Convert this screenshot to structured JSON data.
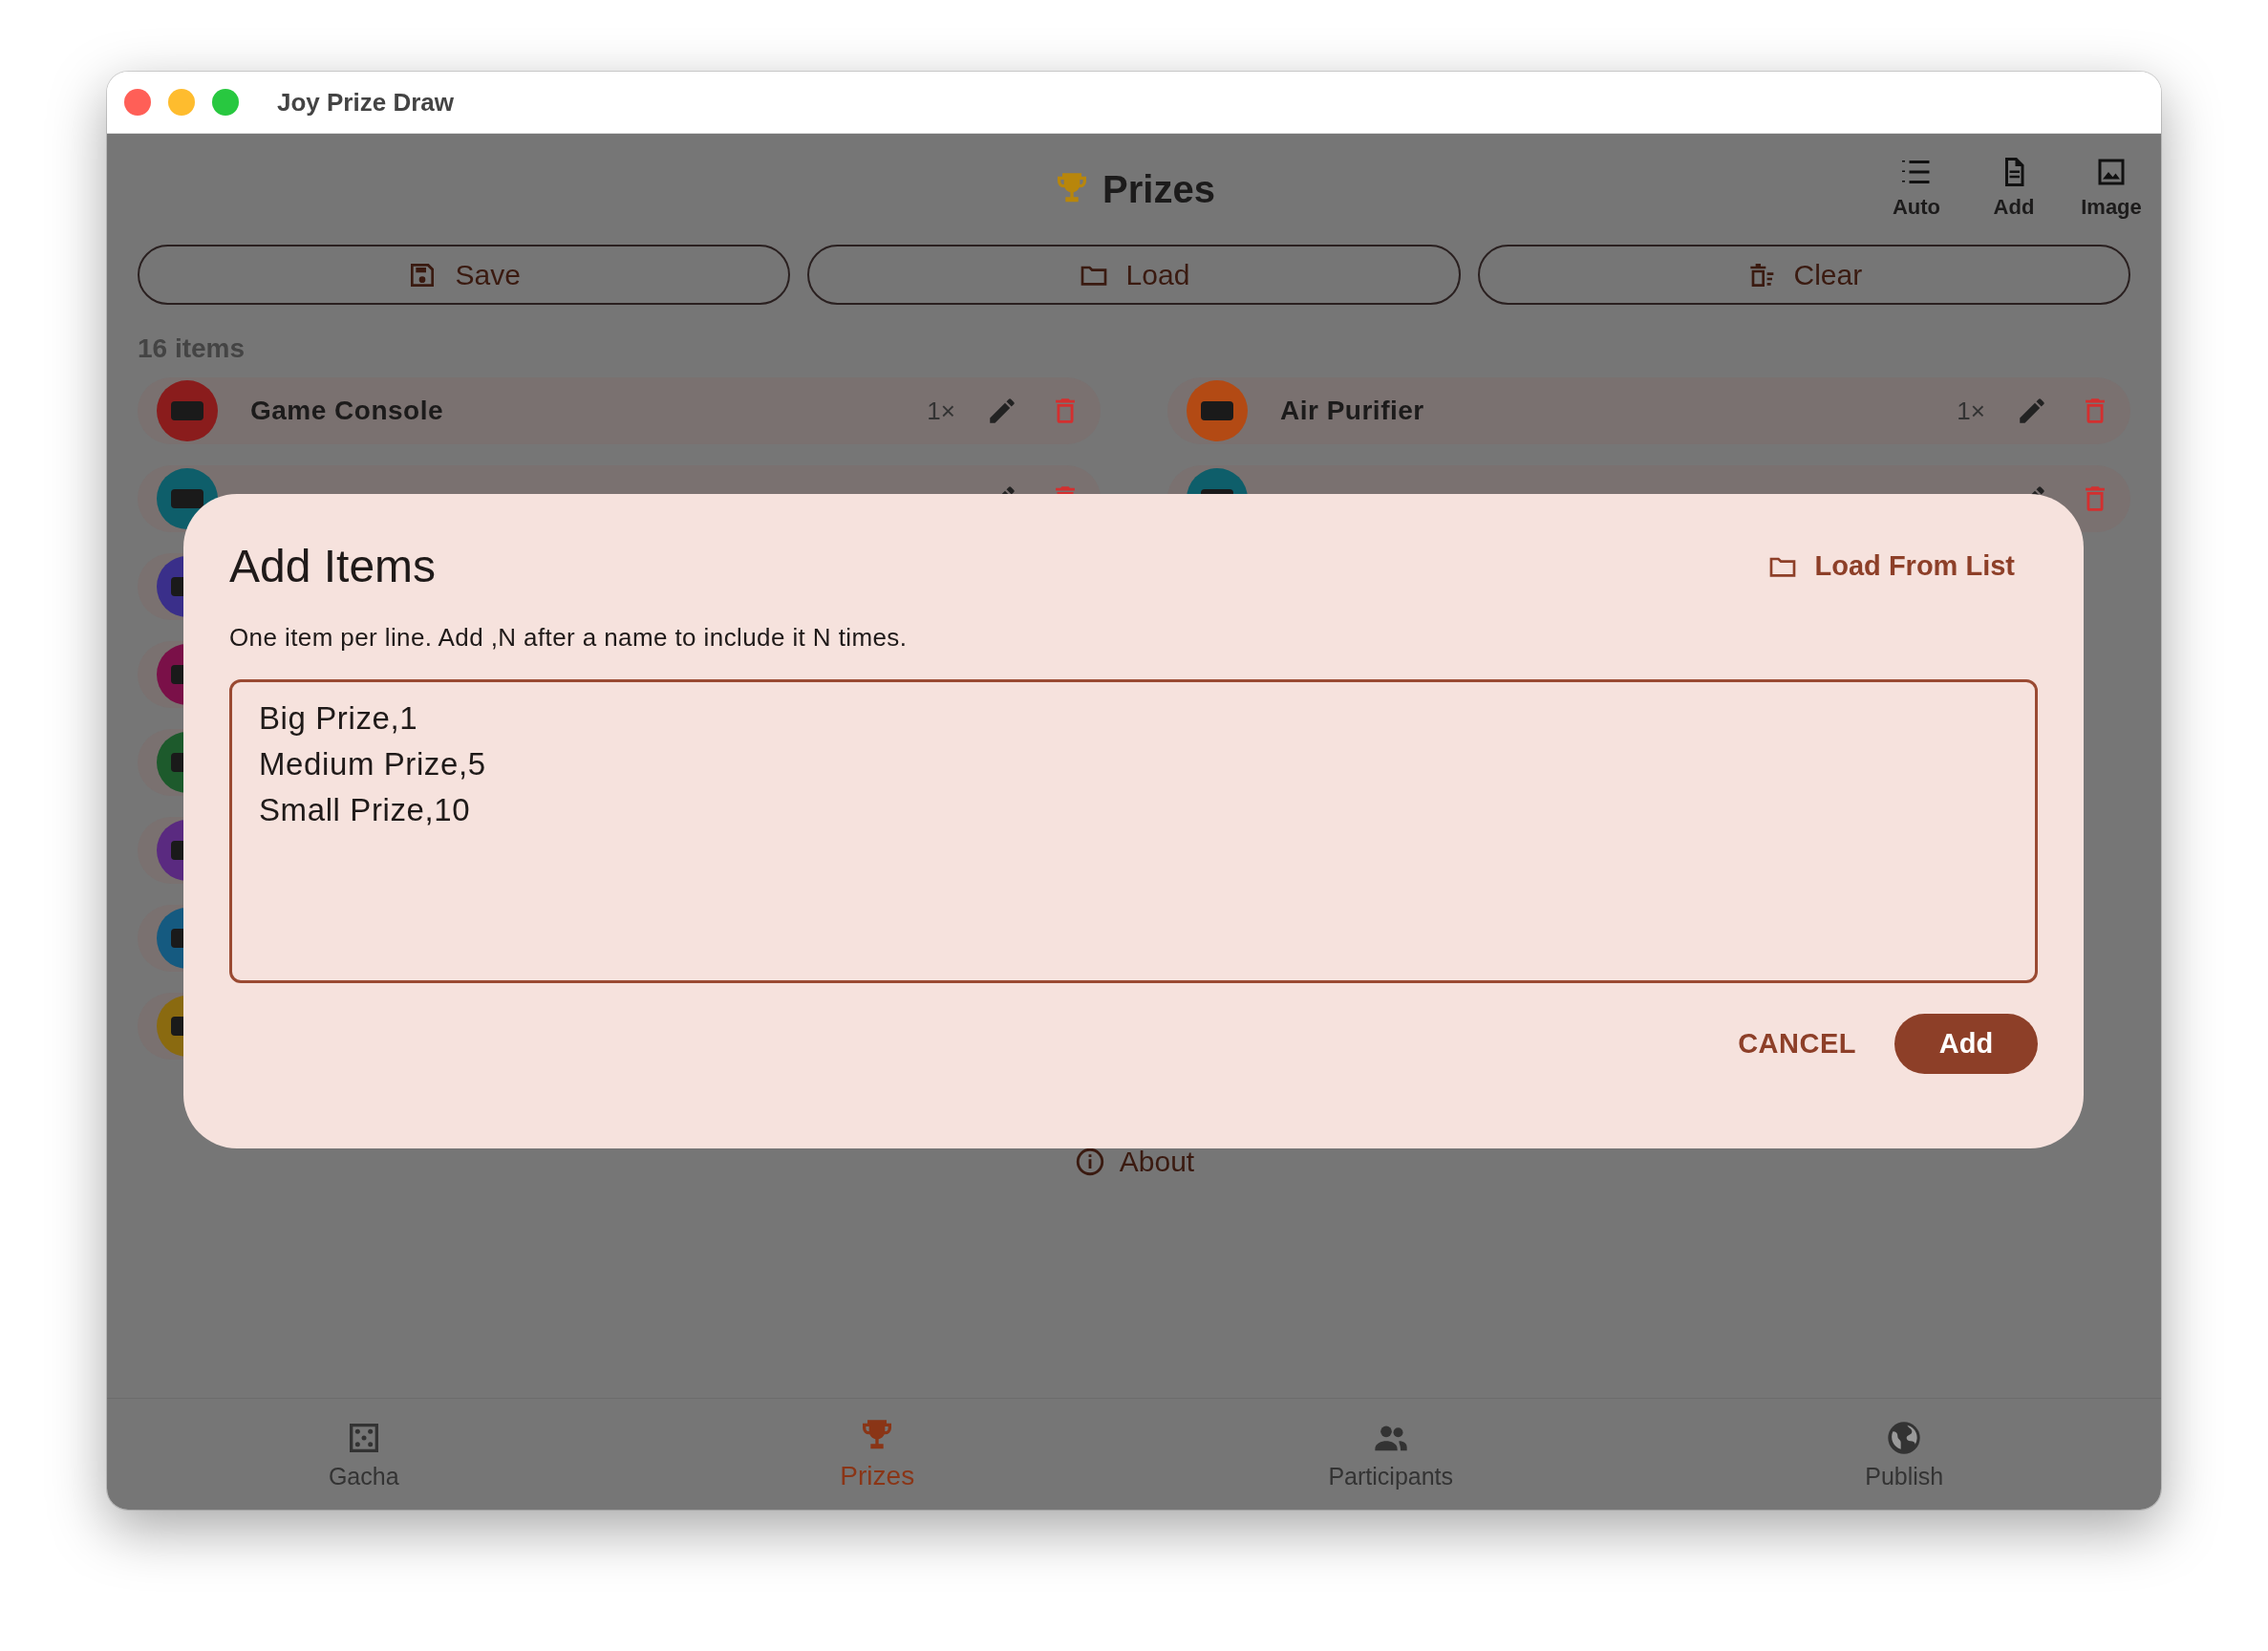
{
  "window": {
    "title": "Joy Prize Draw"
  },
  "header": {
    "title": "Prizes",
    "actions": [
      {
        "kind": "auto",
        "label": "Auto"
      },
      {
        "kind": "add",
        "label": "Add"
      },
      {
        "kind": "image",
        "label": "Image"
      }
    ]
  },
  "toolbar": [
    {
      "kind": "save",
      "label": "Save"
    },
    {
      "kind": "load",
      "label": "Load"
    },
    {
      "kind": "clear",
      "label": "Clear"
    }
  ],
  "item_count": "16 items",
  "prizes": [
    [
      {
        "name": "Game Console",
        "count": "1×",
        "color": "#8a1c1c"
      },
      {
        "color": "#0e5e6a"
      },
      {
        "color": "#3a2f8a"
      },
      {
        "color": "#7a1048"
      },
      {
        "color": "#1d5a2c"
      },
      {
        "color": "#5a2a80"
      },
      {
        "color": "#155a80"
      },
      {
        "color": "#8a6a10"
      }
    ],
    [
      {
        "name": "Air Purifier",
        "count": "1×",
        "color": "#b34a14"
      },
      {
        "color": "#0e5e6a"
      }
    ]
  ],
  "about": "About",
  "dialog": {
    "title": "Add Items",
    "load_from_list": "Load From List",
    "hint": "One item per line. Add ,N after a name to include it N times.",
    "value": "Big Prize,1\nMedium Prize,5\nSmall Prize,10",
    "cancel": "CANCEL",
    "add": "Add"
  },
  "nav": [
    {
      "kind": "dice",
      "label": "Gacha",
      "selected": false
    },
    {
      "kind": "trophy",
      "label": "Prizes",
      "selected": true
    },
    {
      "kind": "people",
      "label": "Participants",
      "selected": false
    },
    {
      "kind": "globe",
      "label": "Publish",
      "selected": false
    }
  ]
}
